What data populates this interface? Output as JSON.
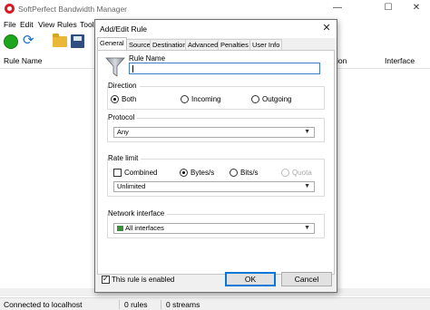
{
  "main": {
    "title": "SoftPerfect Bandwidth Manager",
    "window_controls": {
      "minimize": "—",
      "maximize": "☐",
      "close": "✕"
    },
    "menu": [
      "File",
      "Edit",
      "View",
      "Rules",
      "Tools"
    ],
    "columns": {
      "rule_name": "Rule Name",
      "direction": "ion",
      "interface": "Interface"
    },
    "status": {
      "connection": "Connected to localhost",
      "rules": "0 rules",
      "streams": "0 streams"
    }
  },
  "dialog": {
    "title": "Add/Edit Rule",
    "close": "✕",
    "tabs": [
      "General",
      "Source",
      "Destination",
      "Advanced",
      "Penalties",
      "User Info"
    ],
    "rule_name_label": "Rule Name",
    "rule_name_value": "",
    "direction": {
      "title": "Direction",
      "options": [
        "Both",
        "Incoming",
        "Outgoing"
      ],
      "selected": "Both"
    },
    "protocol": {
      "title": "Protocol",
      "value": "Any"
    },
    "rate_limit": {
      "title": "Rate limit",
      "combined_label": "Combined",
      "combined_checked": false,
      "unit_options": [
        "Bytes/s",
        "Bits/s",
        "Quota"
      ],
      "selected_unit": "Bytes/s",
      "value": "Unlimited"
    },
    "network_interface": {
      "title": "Network interface",
      "value": "All interfaces"
    },
    "enabled_label": "This rule is enabled",
    "enabled_checked": true,
    "ok_label": "OK",
    "cancel_label": "Cancel"
  },
  "colors": {
    "accent": "#0078d7",
    "go": "#1ea51e",
    "app_icon": "#d81b22"
  }
}
